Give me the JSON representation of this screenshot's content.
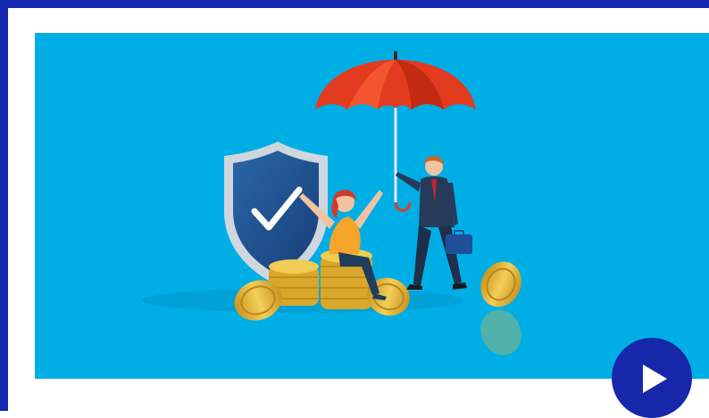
{
  "colors": {
    "frame": "#1526b0",
    "hero_background": "#00aee6",
    "play_button": "#1627a9",
    "umbrella": "#e23b1f",
    "shield": "#1d4f8e",
    "coins": "#e6b935"
  },
  "icons": {
    "play": "play-icon",
    "check": "check-icon"
  }
}
